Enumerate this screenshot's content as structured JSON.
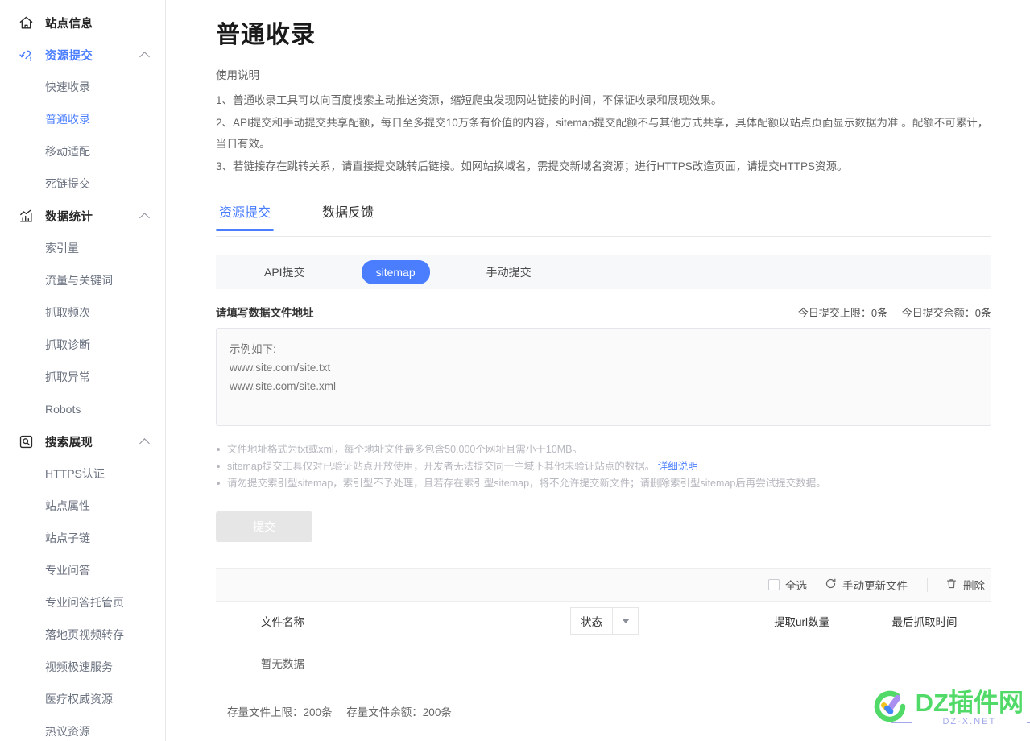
{
  "sidebar": {
    "groups": [
      {
        "label": "站点信息",
        "icon": "home-icon",
        "active": false,
        "expandable": false,
        "children": []
      },
      {
        "label": "资源提交",
        "icon": "submit-resource-icon",
        "active": true,
        "expandable": true,
        "children": [
          {
            "label": "快速收录",
            "active": false
          },
          {
            "label": "普通收录",
            "active": true
          },
          {
            "label": "移动适配",
            "active": false
          },
          {
            "label": "死链提交",
            "active": false
          }
        ]
      },
      {
        "label": "数据统计",
        "icon": "bar-chart-icon",
        "active": false,
        "expandable": true,
        "children": [
          {
            "label": "索引量",
            "active": false
          },
          {
            "label": "流量与关键词",
            "active": false
          },
          {
            "label": "抓取频次",
            "active": false
          },
          {
            "label": "抓取诊断",
            "active": false
          },
          {
            "label": "抓取异常",
            "active": false
          },
          {
            "label": "Robots",
            "active": false
          }
        ]
      },
      {
        "label": "搜索展现",
        "icon": "search-display-icon",
        "active": false,
        "expandable": true,
        "children": [
          {
            "label": "HTTPS认证",
            "active": false
          },
          {
            "label": "站点属性",
            "active": false
          },
          {
            "label": "站点子链",
            "active": false
          },
          {
            "label": "专业问答",
            "active": false
          },
          {
            "label": "专业问答托管页",
            "active": false
          },
          {
            "label": "落地页视频转存",
            "active": false
          },
          {
            "label": "视频极速服务",
            "active": false
          },
          {
            "label": "医疗权威资源",
            "active": false
          },
          {
            "label": "热议资源",
            "active": false
          }
        ]
      }
    ]
  },
  "page": {
    "title": "普通收录",
    "usage_heading": "使用说明",
    "usage_lines": [
      "1、普通收录工具可以向百度搜索主动推送资源，缩短爬虫发现网站链接的时间，不保证收录和展现效果。",
      "2、API提交和手动提交共享配额，每日至多提交10万条有价值的内容，sitemap提交配额不与其他方式共享，具体配额以站点页面显示数据为准 。配额不可累计，当日有效。",
      "3、若链接存在跳转关系，请直接提交跳转后链接。如网站换域名，需提交新域名资源；进行HTTPS改造页面，请提交HTTPS资源。"
    ]
  },
  "tabs": [
    {
      "label": "资源提交",
      "active": true
    },
    {
      "label": "数据反馈",
      "active": false
    }
  ],
  "methods": [
    {
      "label": "API提交",
      "selected": false
    },
    {
      "label": "sitemap",
      "selected": true
    },
    {
      "label": "手动提交",
      "selected": false
    }
  ],
  "form": {
    "label": "请填写数据文件地址",
    "quota_limit_label": "今日提交上限：0条",
    "quota_remain_label": "今日提交余额：0条",
    "textarea_placeholder": "示例如下:\nwww.site.com/site.txt\nwww.site.com/site.xml",
    "textarea_value": "",
    "notes": [
      {
        "text": "文件地址格式为txt或xml，每个地址文件最多包含50,000个网址且需小于10MB。",
        "link": ""
      },
      {
        "text": "sitemap提交工具仅对已验证站点开放使用，开发者无法提交同一主域下其他未验证站点的数据。",
        "link": "详细说明"
      },
      {
        "text": "请勿提交索引型sitemap，索引型不予处理，且若存在索引型sitemap，将不允许提交新文件；请删除索引型sitemap后再尝试提交数据。",
        "link": ""
      }
    ],
    "submit_label": "提交",
    "submit_disabled": true
  },
  "table": {
    "toolbar": {
      "select_all_label": "全选",
      "refresh_label": "手动更新文件",
      "delete_label": "删除"
    },
    "columns": {
      "file_name": "文件名称",
      "state": "状态",
      "url_count": "提取url数量",
      "last_fetch_time": "最后抓取时间"
    },
    "rows": [],
    "empty_text": "暂无数据"
  },
  "footer": {
    "stock_limit_label": "存量文件上限：200条",
    "stock_remain_label": "存量文件余额：200条"
  },
  "watermark": {
    "main": "DZ插件网",
    "sub": "DZ-X.NET"
  },
  "colors": {
    "accent": "#4a7eff",
    "muted": "#b6b8bf",
    "watermark_green": "#4cd964"
  }
}
